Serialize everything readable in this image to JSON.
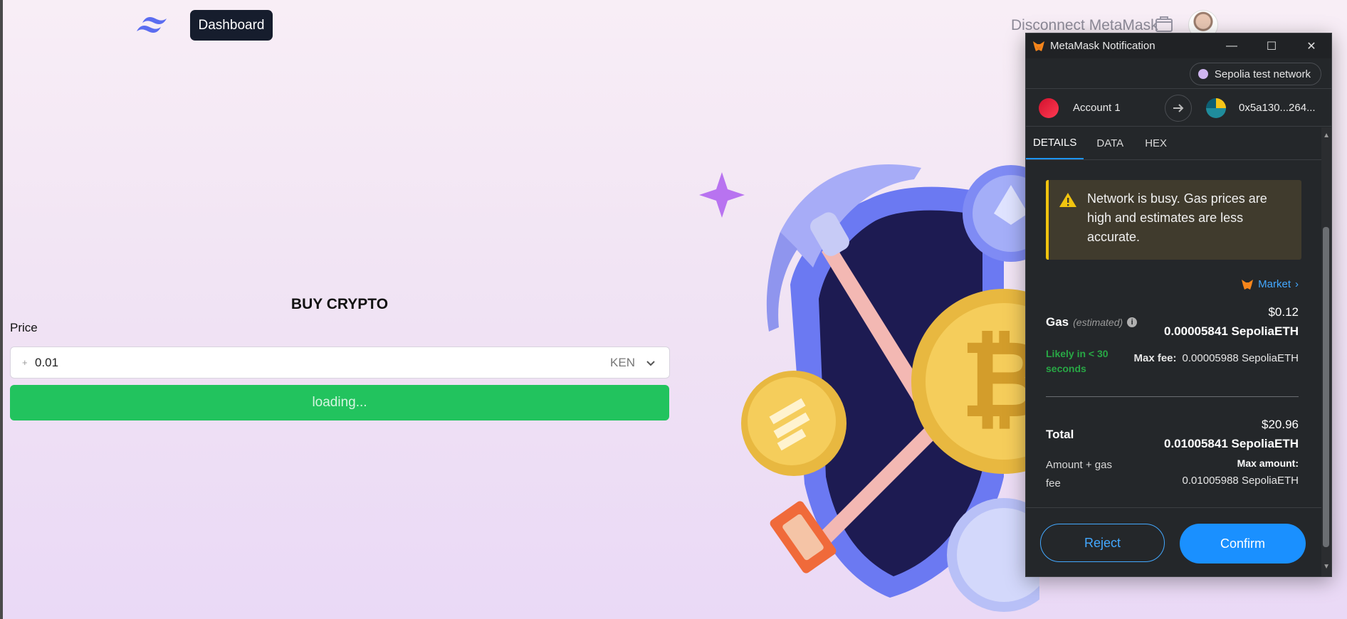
{
  "header": {
    "dashboard_label": "Dashboard",
    "disconnect_label": "Disconnect MetaMask"
  },
  "buy": {
    "title": "BUY CRYPTO",
    "price_label": "Price",
    "price_prefix": "+",
    "price_value": "0.01",
    "currency": "KEN",
    "button_label": "loading..."
  },
  "metamask": {
    "window_title": "MetaMask Notification",
    "network": "Sepolia test network",
    "from_account": "Account 1",
    "to_address": "0x5a130...264...",
    "tabs": [
      "DETAILS",
      "DATA",
      "HEX"
    ],
    "warning": "Network is busy. Gas prices are high and estimates are less accurate.",
    "market_label": "Market",
    "gas": {
      "label": "Gas",
      "estimated": "(estimated)",
      "usd": "$0.12",
      "eth": "0.00005841 SepoliaETH",
      "likely": "Likely in < 30 seconds",
      "max_fee_label": "Max fee:",
      "max_fee_value": "0.00005988 SepoliaETH"
    },
    "total": {
      "label": "Total",
      "usd": "$20.96",
      "eth": "0.01005841 SepoliaETH",
      "amount_gas_label": "Amount + gas fee",
      "max_amount_label": "Max amount:",
      "max_amount_value": "0.01005988 SepoliaETH"
    },
    "reject_label": "Reject",
    "confirm_label": "Confirm"
  },
  "colors": {
    "accent_green": "#22c35e",
    "metamask_blue": "#1a90ff",
    "warning_yellow": "#f1c40f"
  }
}
